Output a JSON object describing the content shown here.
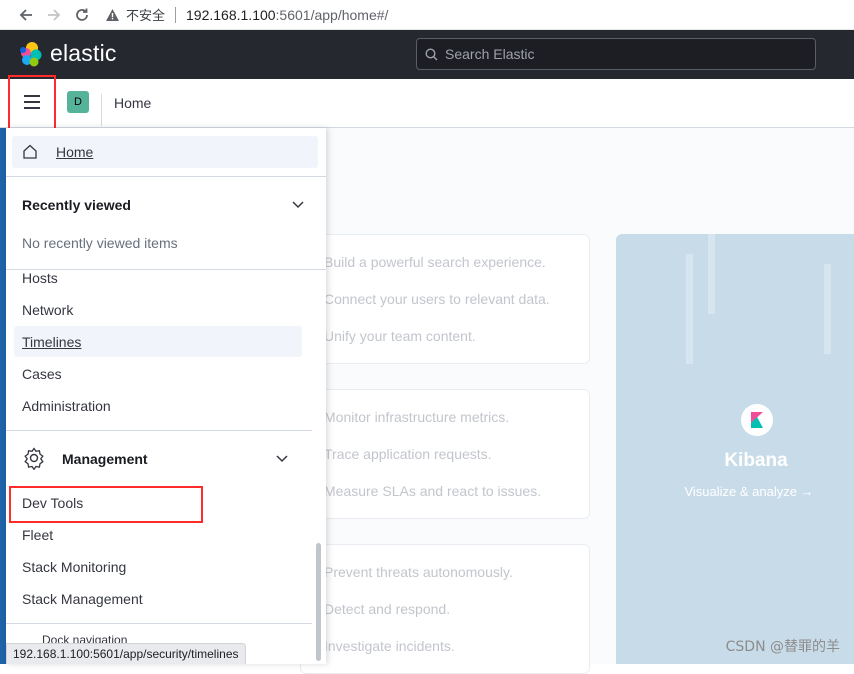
{
  "browser": {
    "back_icon": "arrow-left-icon",
    "forward_icon": "arrow-right-icon",
    "reload_icon": "reload-icon",
    "security_label": "不安全",
    "url_host": "192.168.1.100",
    "url_path": ":5601/app/home#/"
  },
  "header": {
    "logo_text": "elastic",
    "search_placeholder": "Search Elastic"
  },
  "breadcrumb": {
    "space_initial": "D",
    "current": "Home"
  },
  "nav": {
    "home": "Home",
    "recently_viewed_title": "Recently viewed",
    "recently_viewed_empty": "No recently viewed items",
    "security_items": [
      "Hosts",
      "Network",
      "Timelines",
      "Cases",
      "Administration"
    ],
    "active_item": "Timelines",
    "management_title": "Management",
    "management_items": [
      "Dev Tools",
      "Fleet",
      "Stack Monitoring",
      "Stack Management"
    ],
    "dock_label": "Dock navigation"
  },
  "background": {
    "card1": [
      "Build a powerful search experience.",
      "Connect your users to relevant data.",
      "Unify your team content."
    ],
    "card2": [
      "Monitor infrastructure metrics.",
      "Trace application requests.",
      "Measure SLAs and react to issues."
    ],
    "card3": [
      "Prevent threats autonomously.",
      "Detect and respond.",
      "Investigate incidents."
    ],
    "kibana_title": "Kibana",
    "kibana_link": "Visualize & analyze →"
  },
  "status_bar_url": "192.168.1.100:5601/app/security/timelines",
  "watermark": "CSDN @替罪的羊",
  "colors": {
    "header_bg": "#25282f",
    "highlight_box": "#ff2a2a",
    "space_avatar": "#54b399",
    "kibana_panel": "#c8dbe9"
  }
}
